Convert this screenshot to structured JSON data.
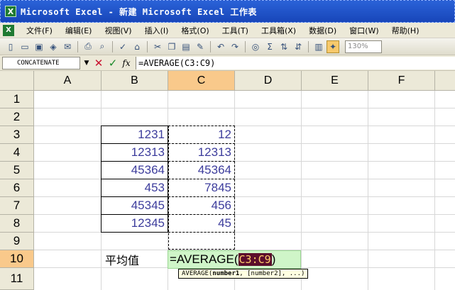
{
  "window": {
    "title": "Microsoft Excel - 新建 Microsoft Excel 工作表",
    "app_icon": "X"
  },
  "menu": {
    "icon": "X",
    "items": [
      "文件(F)",
      "编辑(E)",
      "视图(V)",
      "插入(I)",
      "格式(O)",
      "工具(T)",
      "工具箱(X)",
      "数据(D)",
      "窗口(W)",
      "帮助(H)"
    ]
  },
  "toolbar": {
    "zoom": "130%",
    "sum_symbol": "Σ",
    "icons": [
      "new-icon",
      "open-icon",
      "save-icon",
      "permission-icon",
      "email-icon",
      "print-icon",
      "print-preview-icon",
      "spelling-icon",
      "research-icon",
      "cut-icon",
      "copy-icon",
      "paste-icon",
      "format-painter-icon",
      "undo-icon",
      "redo-icon",
      "hyperlink-icon",
      "autosum-icon",
      "sort-ascending-icon",
      "sort-descending-icon",
      "chart-wizard-icon",
      "drawing-icon"
    ]
  },
  "formula_bar": {
    "name_box": "CONCATENATE",
    "cancel": "✕",
    "enter": "✓",
    "fx": "fx",
    "formula": "=AVERAGE(C3:C9)"
  },
  "sheet": {
    "columns": [
      "A",
      "B",
      "C",
      "D",
      "E",
      "F"
    ],
    "selected_column": "C",
    "rows": [
      "1",
      "2",
      "3",
      "4",
      "5",
      "6",
      "7",
      "8",
      "9",
      "10",
      "11"
    ],
    "selected_row": "10",
    "column_b": [
      "1231",
      "12313",
      "45364",
      "453",
      "45345",
      "12345"
    ],
    "column_c": [
      "12",
      "12313",
      "45364",
      "7845",
      "456",
      "45"
    ],
    "label_b10": "平均值",
    "edit": {
      "prefix": "=AVERAGE(",
      "ref": "C3:C9",
      "suffix": ")"
    },
    "tooltip": {
      "func": "AVERAGE(",
      "arg1": "number1",
      "rest": ", [number2], ...)"
    }
  },
  "colors": {
    "title_bar": "#1846b9",
    "selected_header": "#f9c98b",
    "edit_cell": "#cff5c8",
    "ref_highlight": "#5b0d2b",
    "number_text": "#3c3c9c"
  }
}
